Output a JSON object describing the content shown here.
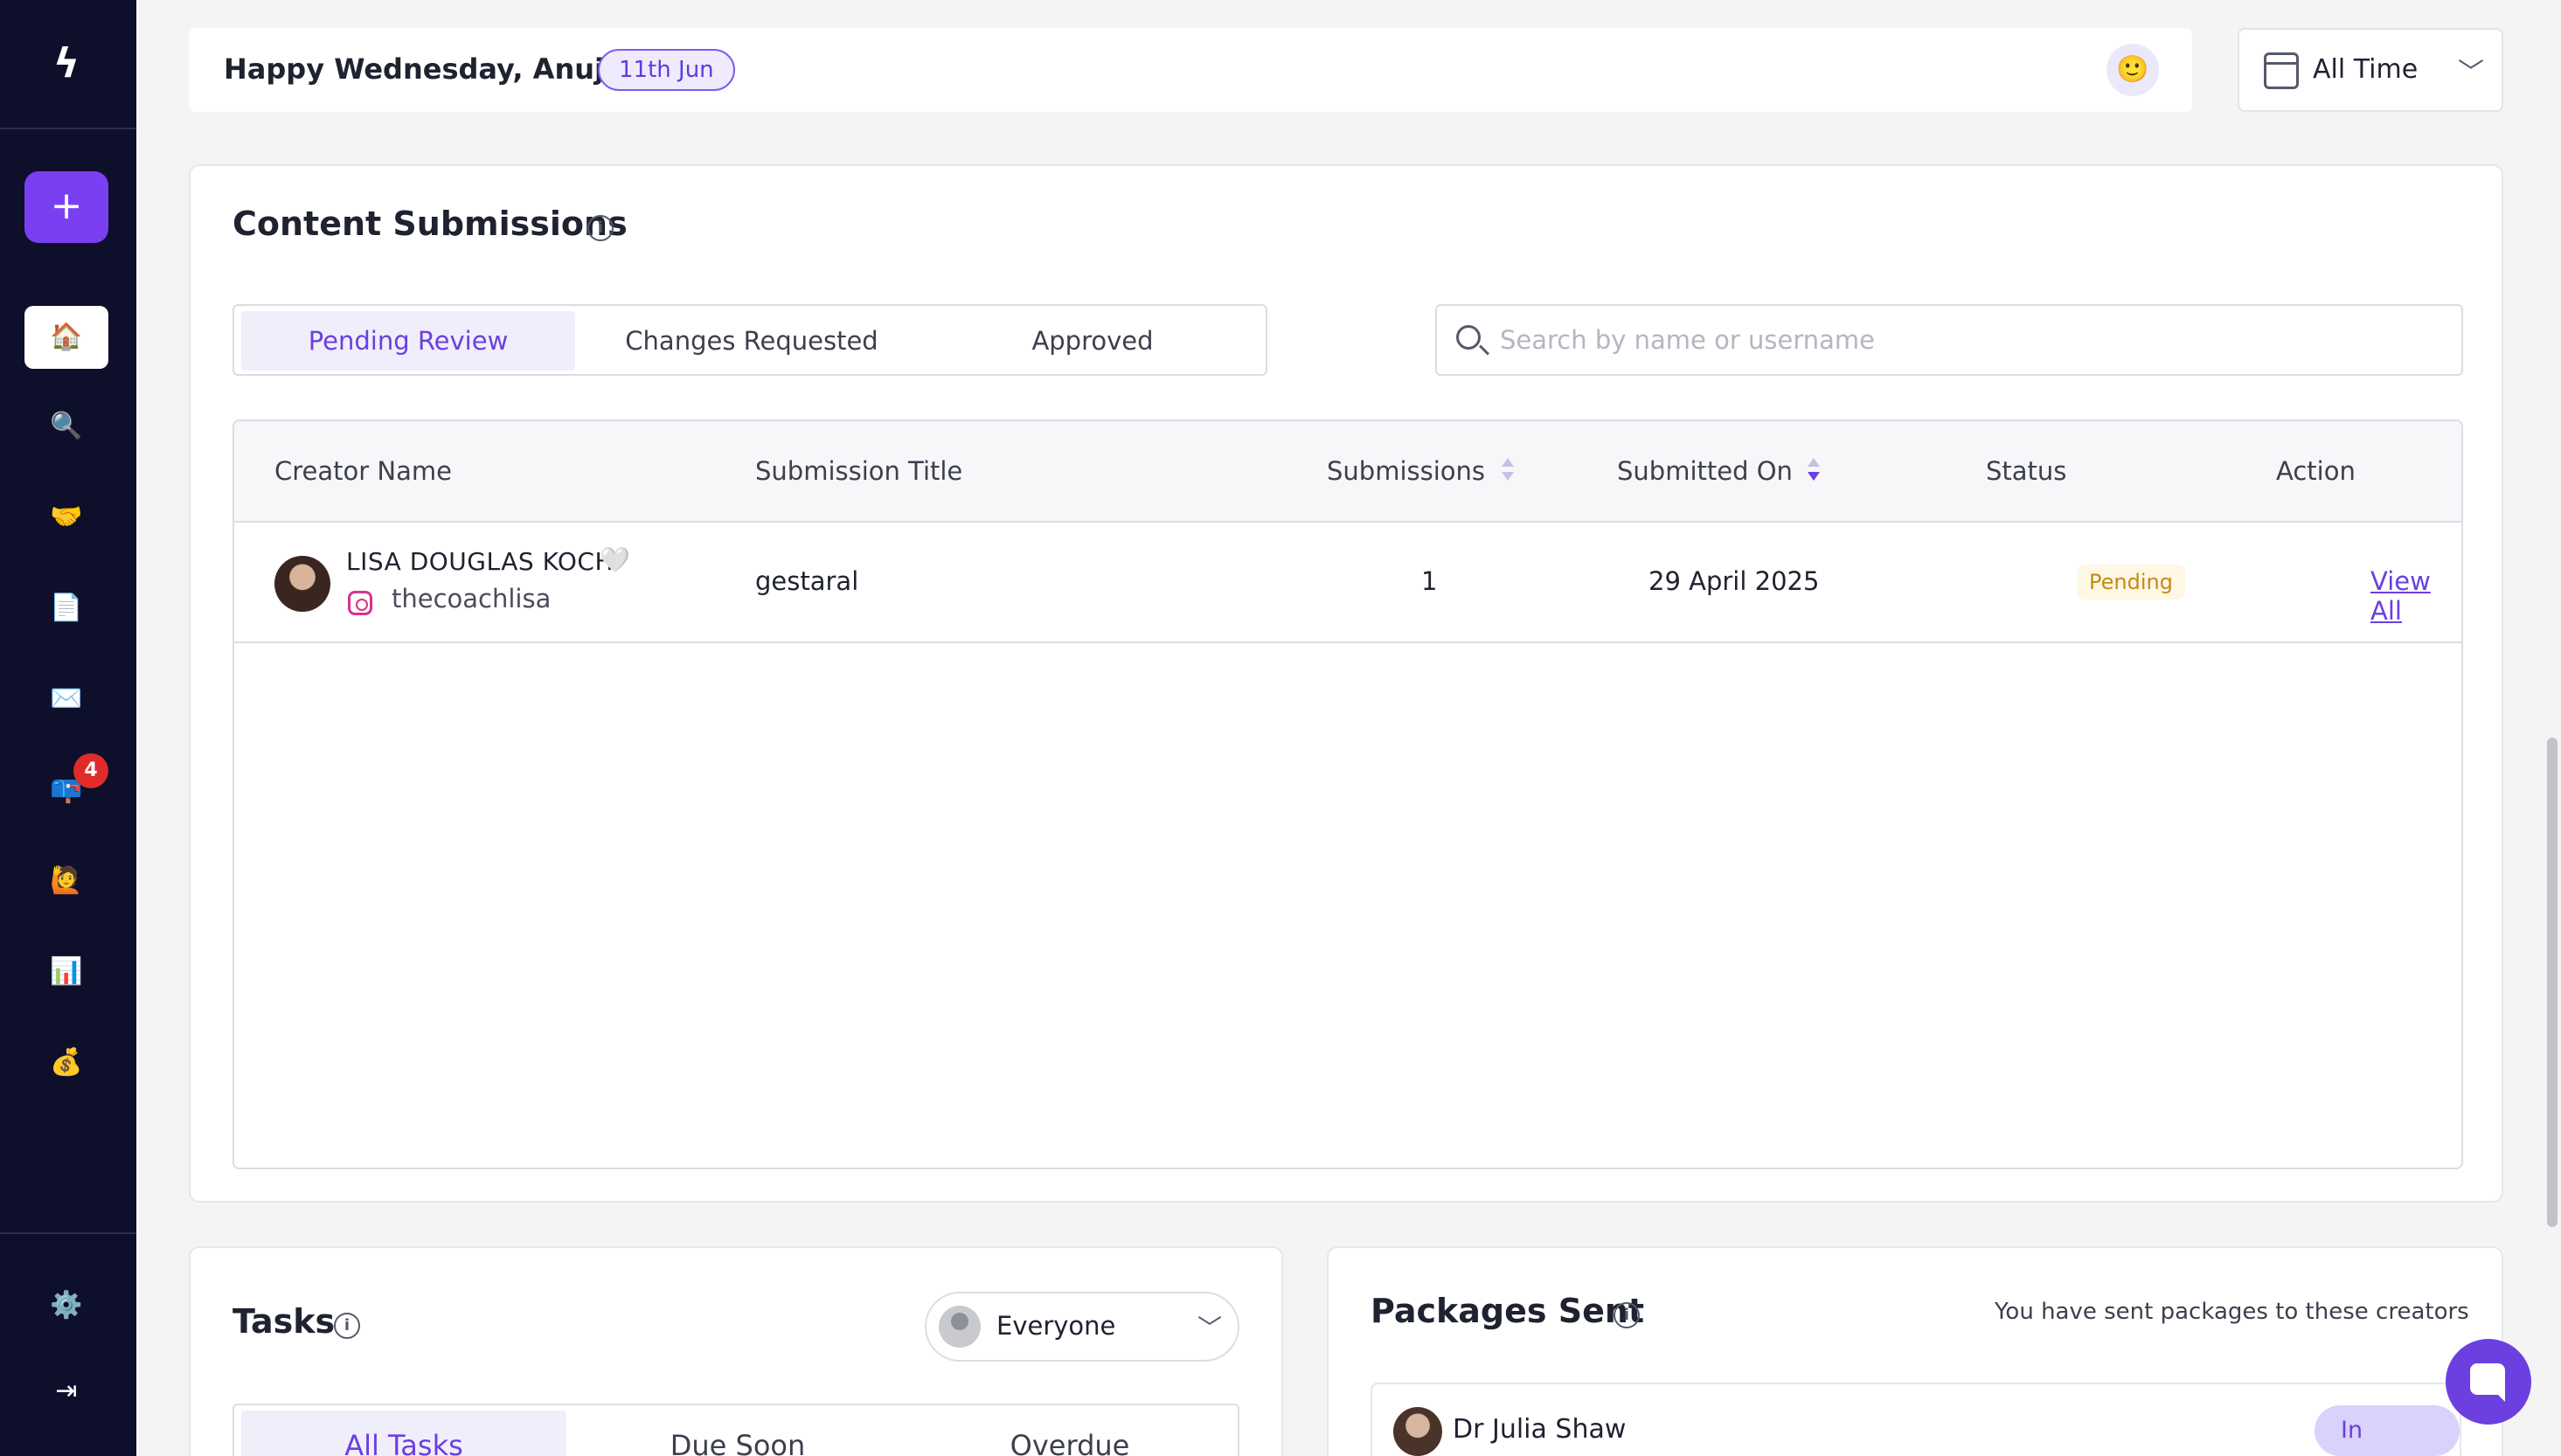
{
  "sidebar": {
    "logo_glyph": "ϟ",
    "add_label": "+",
    "items": [
      {
        "icon": "home-icon",
        "glyph": "🏠"
      },
      {
        "icon": "search-icon",
        "glyph": "🔍"
      },
      {
        "icon": "handshake-icon",
        "glyph": "🤝"
      },
      {
        "icon": "document-icon",
        "glyph": "📄"
      },
      {
        "icon": "mail-icon",
        "glyph": "✉️"
      },
      {
        "icon": "inbox-icon",
        "glyph": "📪"
      },
      {
        "icon": "person-icon",
        "glyph": "🙋"
      },
      {
        "icon": "chart-icon",
        "glyph": "📊"
      },
      {
        "icon": "money-bag-icon",
        "glyph": "💰"
      },
      {
        "icon": "gear-icon",
        "glyph": "⚙️"
      },
      {
        "icon": "logout-icon",
        "glyph": "⇥"
      }
    ],
    "inbox_badge": "4"
  },
  "header": {
    "greeting": "Happy Wednesday, Anuj!",
    "date_pill": "11th Jun",
    "emoji": "🙂",
    "time_filter": "All Time"
  },
  "content_submissions": {
    "title": "Content Submissions",
    "tabs": [
      "Pending Review",
      "Changes Requested",
      "Approved"
    ],
    "search_placeholder": "Search by name or username",
    "columns": [
      "Creator Name",
      "Submission Title",
      "Submissions",
      "Submitted On",
      "Status",
      "Action"
    ],
    "rows": [
      {
        "creator_name": "LISA DOUGLAS KOCH",
        "heart": "🤍",
        "username": "thecoachlisa",
        "title": "gestaral",
        "submissions": "1",
        "submitted_on": "29 April 2025",
        "status": "Pending",
        "action": "View All"
      }
    ]
  },
  "tasks": {
    "title": "Tasks",
    "assignee": "Everyone",
    "tabs": [
      "All Tasks",
      "Due Soon",
      "Overdue"
    ]
  },
  "packages": {
    "title": "Packages Sent",
    "subtitle": "You have sent packages to these creators",
    "rows": [
      {
        "name": "Dr Julia Shaw",
        "status": "In Transit"
      }
    ]
  },
  "colors": {
    "accent": "#6b3fe0",
    "sidebar_bg": "#0e0f2a",
    "pending": "#c58a15",
    "badge": "#e02b2b"
  }
}
